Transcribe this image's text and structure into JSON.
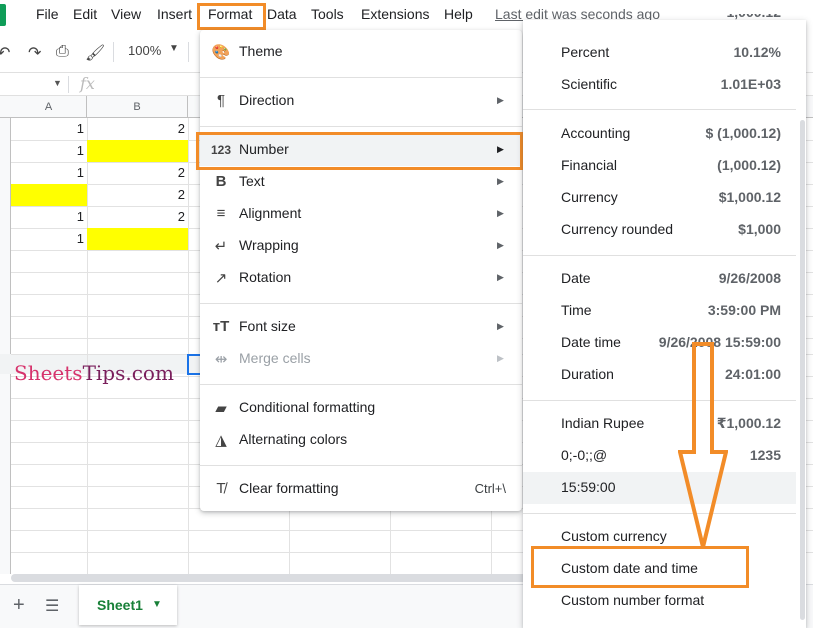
{
  "menubar": {
    "items": [
      {
        "label": "File"
      },
      {
        "label": "Edit"
      },
      {
        "label": "View"
      },
      {
        "label": "Insert"
      },
      {
        "label": "Format"
      },
      {
        "label": "Data"
      },
      {
        "label": "Tools"
      },
      {
        "label": "Extensions"
      },
      {
        "label": "Help"
      }
    ],
    "last_edit": "Last edit was seconds ago",
    "active_item": "Format"
  },
  "toolbar": {
    "zoom": "100%",
    "icons": [
      "undo-icon",
      "redo-icon",
      "print-icon",
      "paint-format-icon"
    ]
  },
  "formula_bar": {
    "fx_label": "fx",
    "value": ""
  },
  "grid": {
    "columns": [
      {
        "label": "A"
      },
      {
        "label": "B"
      }
    ],
    "rows": [
      {
        "a": "1",
        "b": "2",
        "a_yellow": false,
        "b_yellow": false
      },
      {
        "a": "1",
        "b": "",
        "a_yellow": false,
        "b_yellow": true
      },
      {
        "a": "1",
        "b": "2",
        "a_yellow": false,
        "b_yellow": false
      },
      {
        "a": "",
        "b": "2",
        "a_yellow": true,
        "b_yellow": false
      },
      {
        "a": "1",
        "b": "2",
        "a_yellow": false,
        "b_yellow": false
      },
      {
        "a": "1",
        "b": "",
        "a_yellow": false,
        "b_yellow": true
      }
    ],
    "highlight_color": "#ffff00"
  },
  "watermark": {
    "part1": "Sheets",
    "part2": "Tips",
    "part3": ".com"
  },
  "bottombar": {
    "add_sheet": "+",
    "sheet_tab": "Sheet1"
  },
  "format_menu": {
    "items": [
      {
        "label": "Theme",
        "icon": "palette-icon",
        "arrow": false
      },
      {
        "label": "Direction",
        "icon": "direction-icon",
        "arrow": true
      },
      {
        "label": "Number",
        "icon": "number-format-icon",
        "arrow": true,
        "active": true
      },
      {
        "label": "Text",
        "icon": "bold-icon",
        "arrow": true
      },
      {
        "label": "Alignment",
        "icon": "align-icon",
        "arrow": true
      },
      {
        "label": "Wrapping",
        "icon": "wrap-icon",
        "arrow": true
      },
      {
        "label": "Rotation",
        "icon": "rotation-icon",
        "arrow": true
      },
      {
        "label": "Font size",
        "icon": "font-size-icon",
        "arrow": true
      },
      {
        "label": "Merge cells",
        "icon": "merge-icon",
        "arrow": true,
        "disabled": true
      },
      {
        "label": "Conditional formatting",
        "icon": "conditional-formatting-icon",
        "arrow": false
      },
      {
        "label": "Alternating colors",
        "icon": "alternating-colors-icon",
        "arrow": false
      },
      {
        "label": "Clear formatting",
        "icon": "clear-formatting-icon",
        "arrow": false,
        "shortcut": "Ctrl+\\"
      }
    ]
  },
  "number_submenu": {
    "items": [
      {
        "label": "Percent",
        "value": "10.12%"
      },
      {
        "label": "Scientific",
        "value": "1.01E+03"
      },
      {
        "label": "Accounting",
        "value": "$ (1,000.12)"
      },
      {
        "label": "Financial",
        "value": "(1,000.12)"
      },
      {
        "label": "Currency",
        "value": "$1,000.12"
      },
      {
        "label": "Currency rounded",
        "value": "$1,000"
      },
      {
        "label": "Date",
        "value": "9/26/2008"
      },
      {
        "label": "Time",
        "value": "3:59:00 PM"
      },
      {
        "label": "Date time",
        "value": "9/26/2008 15:59:00"
      },
      {
        "label": "Duration",
        "value": "24:01:00"
      },
      {
        "label": "Indian Rupee",
        "value": "₹1,000.12"
      },
      {
        "label": "0;-0;;@",
        "value": "1235"
      },
      {
        "label": "15:59:00",
        "value": ""
      },
      {
        "label": "Custom currency",
        "value": ""
      },
      {
        "label": "Custom date and time",
        "value": ""
      },
      {
        "label": "Custom number format",
        "value": ""
      }
    ]
  },
  "annotations": {
    "highlight_color": "#f28c28"
  }
}
